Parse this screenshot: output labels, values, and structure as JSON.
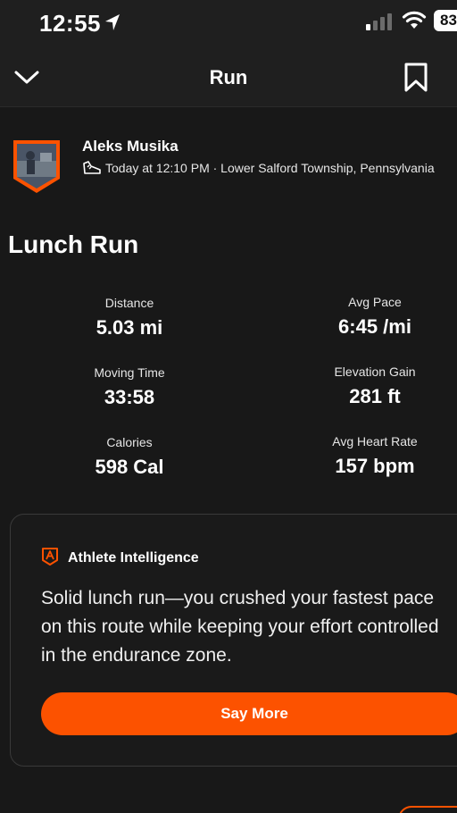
{
  "status_bar": {
    "time": "12:55",
    "battery": "83"
  },
  "nav": {
    "title": "Run"
  },
  "athlete": {
    "name": "Aleks Musika",
    "meta": "Today at 12:10 PM · Lower Salford Township, Pennsylvania"
  },
  "activity": {
    "title": "Lunch Run"
  },
  "stats": [
    {
      "label": "Distance",
      "value": "5.03 mi"
    },
    {
      "label": "Avg Pace",
      "value": "6:45 /mi"
    },
    {
      "label": "Moving Time",
      "value": "33:58"
    },
    {
      "label": "Elevation Gain",
      "value": "281 ft"
    },
    {
      "label": "Calories",
      "value": "598 Cal"
    },
    {
      "label": "Avg Heart Rate",
      "value": "157 bpm"
    }
  ],
  "insight": {
    "header": "Athlete Intelligence",
    "text": "Solid lunch run—you crushed your fastest pace on this route while keeping your effort controlled in the endurance zone.",
    "button": "Say More"
  },
  "colors": {
    "accent": "#fc5200",
    "background": "#181818"
  }
}
